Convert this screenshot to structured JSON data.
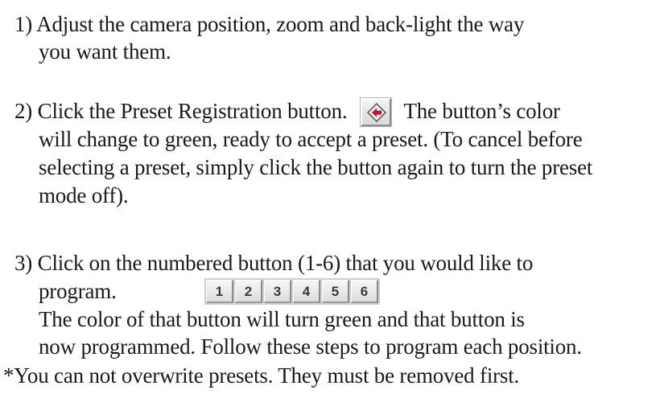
{
  "steps": [
    {
      "lines": [
        "1) Adjust the camera position, zoom and back-light the way",
        "you want them."
      ]
    },
    {
      "lines": [
        "2) Click the Preset Registration button.",
        "The button’s color",
        "will change to green, ready to accept a preset. (To cancel before",
        "selecting a preset, simply click the button again to turn the preset",
        "mode off)."
      ],
      "icon": "preset-registration-icon"
    },
    {
      "lines": [
        "3) Click on the numbered button (1-6) that you would like to",
        "program.",
        "The color of that button will turn green and that button is",
        "now programmed. Follow these steps to program each position."
      ],
      "number_buttons": [
        "1",
        "2",
        "3",
        "4",
        "5",
        "6"
      ]
    }
  ],
  "note": "*You can not overwrite presets. They must be removed first.",
  "colors": {
    "text": "#1a1a1a",
    "icon_arrow": "#c8102e",
    "button_face": "#e6e6e6"
  }
}
